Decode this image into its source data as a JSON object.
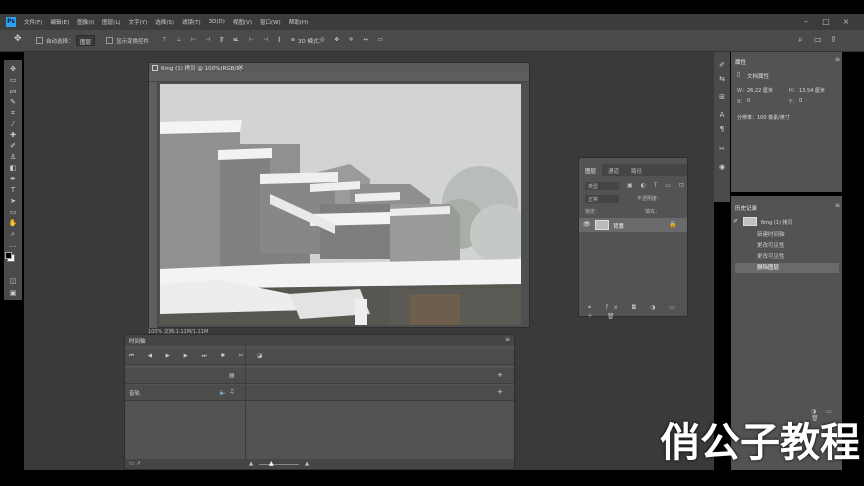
{
  "menu": {
    "logo": "Ps",
    "items": [
      "文件(F)",
      "编辑(E)",
      "图像(I)",
      "图层(L)",
      "文字(Y)",
      "选择(S)",
      "滤镜(T)",
      "3D(D)",
      "视图(V)",
      "窗口(W)",
      "帮助(H)"
    ]
  },
  "options": {
    "auto_select": "自动选择：",
    "auto_select_target": "图层",
    "show_transform": "显示变换控件",
    "mode_3d": "3D 模式："
  },
  "document": {
    "tab_title": "6mg (1) 拷贝 @ 100%(RGB/8)",
    "status": "100%    文档:1.11M/1.11M"
  },
  "timeline": {
    "title": "时间轴",
    "track_label": "音轨"
  },
  "layers": {
    "tabs": [
      "图层",
      "通道",
      "路径"
    ],
    "search": "类型",
    "blend": "正常",
    "opacity": "不透明度：",
    "lock": "锁定：",
    "fill": "填充：",
    "layer_name": "背景"
  },
  "properties": {
    "title": "属性",
    "doc_props": "文档属性",
    "w_label": "W：",
    "w_val": "26.22 厘米",
    "h_label": "H：",
    "h_val": "13.54 厘米",
    "x_label": "X：",
    "x_val": "0",
    "y_label": "Y：",
    "y_val": "0",
    "resolution": "分辨率：100 像素/英寸"
  },
  "history": {
    "title": "历史记录",
    "snapshot": "6mg (1) 拷贝",
    "items": [
      "新建时间轴",
      "更改可见性",
      "更改可见性",
      "删除图层"
    ]
  },
  "watermark": "俏公子教程"
}
